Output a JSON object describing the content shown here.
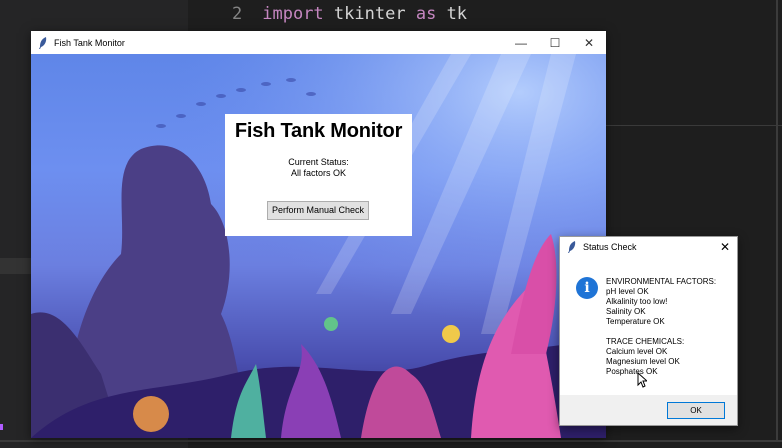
{
  "editor": {
    "line_number": "2",
    "keyword_import": "import",
    "module": "tkinter",
    "keyword_as": "as",
    "alias": "tk"
  },
  "main_window": {
    "title": "Fish Tank Monitor",
    "minimize": "—",
    "maximize": "☐",
    "close": "✕",
    "panel": {
      "heading": "Fish Tank Monitor",
      "status_label": "Current Status:",
      "status_value": "All factors OK",
      "check_button": "Perform Manual Check"
    }
  },
  "dialog": {
    "title": "Status Check",
    "close": "✕",
    "icon": "info-icon",
    "lines_env": [
      "ENVIRONMENTAL FACTORS:",
      "pH level OK",
      "Alkalinity too low!",
      "Salinity OK",
      "Temperature OK"
    ],
    "lines_trace": [
      "TRACE CHEMICALS:",
      "Calcium level OK",
      "Magnesium level OK",
      "Posphates OK"
    ],
    "ok_button": "OK"
  }
}
